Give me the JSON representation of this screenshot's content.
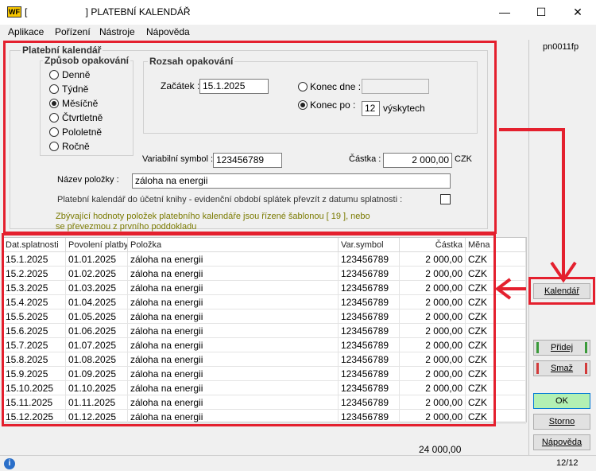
{
  "window": {
    "logo_text": "WF",
    "title": "[                      ] PLATEBNÍ KALENDÁŘ",
    "minimize": "—",
    "maximize": "☐",
    "close": "✕"
  },
  "menu": [
    "Aplikace",
    "Pořízení",
    "Nástroje",
    "Nápověda"
  ],
  "form_code": "pn0011fp",
  "form": {
    "group_title": "Platební kalendář",
    "repeat_mode": {
      "title": "Způsob opakování",
      "options": [
        "Denně",
        "Týdně",
        "Měsíčně",
        "Čtvrtletně",
        "Pololetně",
        "Ročně"
      ],
      "selected": "Měsíčně"
    },
    "range": {
      "title": "Rozsah opakování",
      "start_label": "Začátek :",
      "start_value": "15.1.2025",
      "end_date_label": "Konec dne :",
      "end_date_value": "",
      "end_after_label": "Konec po :",
      "end_after_value": "12",
      "occurrences_label": "výskytech",
      "selected": "Konec po"
    },
    "var_symbol_label": "Variabilní symbol :",
    "var_symbol_value": "123456789",
    "amount_label": "Částka :",
    "amount_value": "2 000,00",
    "currency": "CZK",
    "item_name_label": "Název položky :",
    "item_name_value": "záloha na energii",
    "accounting_label": "Platební kalendář do účetní knihy - evidenční období splátek převzít z datumu splatnosti :",
    "accounting_checked": false,
    "note_line1": "Zbývající hodnoty položek platebního kalendáře jsou řízené šablonou [ 19 ], nebo",
    "note_line2": "se převezmou z  prvního poddokladu"
  },
  "table": {
    "columns": [
      "Dat.splatnosti",
      "Povolení platby",
      "Položka",
      "Var.symbol",
      "Částka",
      "Měna"
    ],
    "rows": [
      [
        "15.1.2025",
        "01.01.2025",
        "záloha na energii",
        "123456789",
        "2 000,00",
        "CZK"
      ],
      [
        "15.2.2025",
        "01.02.2025",
        "záloha na energii",
        "123456789",
        "2 000,00",
        "CZK"
      ],
      [
        "15.3.2025",
        "01.03.2025",
        "záloha na energii",
        "123456789",
        "2 000,00",
        "CZK"
      ],
      [
        "15.4.2025",
        "01.04.2025",
        "záloha na energii",
        "123456789",
        "2 000,00",
        "CZK"
      ],
      [
        "15.5.2025",
        "01.05.2025",
        "záloha na energii",
        "123456789",
        "2 000,00",
        "CZK"
      ],
      [
        "15.6.2025",
        "01.06.2025",
        "záloha na energii",
        "123456789",
        "2 000,00",
        "CZK"
      ],
      [
        "15.7.2025",
        "01.07.2025",
        "záloha na energii",
        "123456789",
        "2 000,00",
        "CZK"
      ],
      [
        "15.8.2025",
        "01.08.2025",
        "záloha na energii",
        "123456789",
        "2 000,00",
        "CZK"
      ],
      [
        "15.9.2025",
        "01.09.2025",
        "záloha na energii",
        "123456789",
        "2 000,00",
        "CZK"
      ],
      [
        "15.10.2025",
        "01.10.2025",
        "záloha na energii",
        "123456789",
        "2 000,00",
        "CZK"
      ],
      [
        "15.11.2025",
        "01.11.2025",
        "záloha na energii",
        "123456789",
        "2 000,00",
        "CZK"
      ],
      [
        "15.12.2025",
        "01.12.2025",
        "záloha na energii",
        "123456789",
        "2 000,00",
        "CZK"
      ]
    ],
    "total": "24 000,00"
  },
  "buttons": {
    "calendar": "Kalendář",
    "add": "Přidej",
    "delete": "Smaž",
    "ok": "OK",
    "cancel": "Storno",
    "help": "Nápověda"
  },
  "status": {
    "info_icon": "i",
    "record_count": "12/12"
  },
  "colors": {
    "annotation_red": "#e4202e",
    "ok_green": "#b3f0b3",
    "add_green": "#3a9a3a",
    "delete_red": "#d23a3a",
    "note_text": "#7a7a00"
  }
}
